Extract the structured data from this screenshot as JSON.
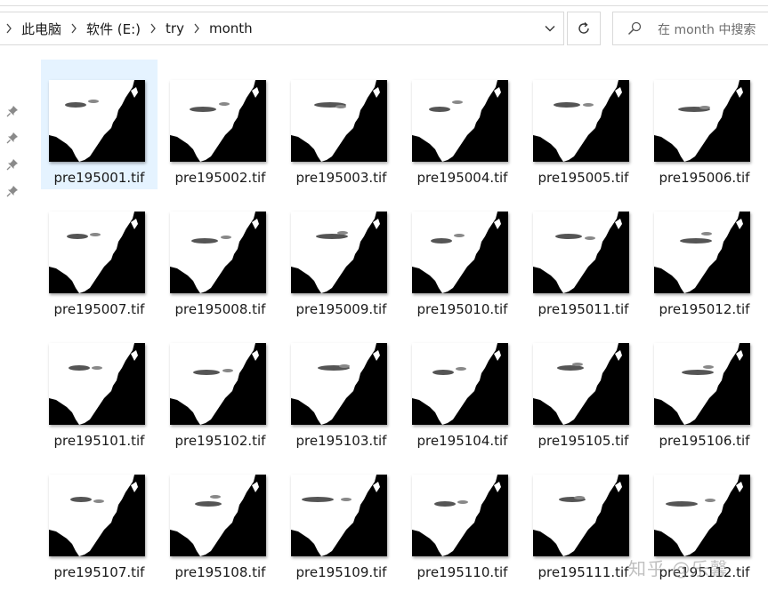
{
  "address": {
    "crumbs": [
      "此电脑",
      "软件 (E:)",
      "try",
      "month"
    ]
  },
  "search": {
    "placeholder": "在 month 中搜索"
  },
  "files": [
    {
      "name": "pre195001.tif",
      "selected": true
    },
    {
      "name": "pre195002.tif"
    },
    {
      "name": "pre195003.tif"
    },
    {
      "name": "pre195004.tif"
    },
    {
      "name": "pre195005.tif"
    },
    {
      "name": "pre195006.tif"
    },
    {
      "name": "pre195007.tif"
    },
    {
      "name": "pre195008.tif"
    },
    {
      "name": "pre195009.tif"
    },
    {
      "name": "pre195010.tif"
    },
    {
      "name": "pre195011.tif"
    },
    {
      "name": "pre195012.tif"
    },
    {
      "name": "pre195101.tif"
    },
    {
      "name": "pre195102.tif"
    },
    {
      "name": "pre195103.tif"
    },
    {
      "name": "pre195104.tif"
    },
    {
      "name": "pre195105.tif"
    },
    {
      "name": "pre195106.tif"
    },
    {
      "name": "pre195107.tif"
    },
    {
      "name": "pre195108.tif"
    },
    {
      "name": "pre195109.tif"
    },
    {
      "name": "pre195110.tif"
    },
    {
      "name": "pre195111.tif"
    },
    {
      "name": "pre195112.tif"
    }
  ],
  "watermark": "知乎 @乐馨",
  "colors": {
    "selection": "#e5f3ff",
    "border": "#d9d9d9"
  }
}
